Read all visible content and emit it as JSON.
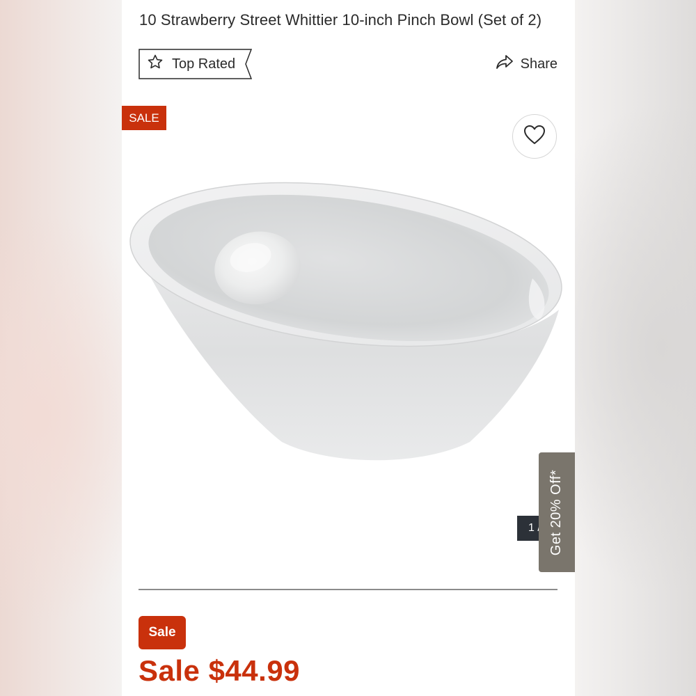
{
  "product": {
    "title": "10 Strawberry Street Whittier 10-inch Pinch Bowl (Set of 2)",
    "image_alt": "White porcelain angled pinch bowl",
    "image_counter": "1 /",
    "sale_badge": "SALE"
  },
  "badges": {
    "top_rated_label": "Top Rated"
  },
  "actions": {
    "share_label": "Share",
    "favorite_icon": "heart-icon"
  },
  "promo": {
    "tab_label": "Get 20% Off*"
  },
  "pricing": {
    "sale_pill": "Sale",
    "price_label": "Sale $44.99"
  },
  "colors": {
    "accent": "#c9310c",
    "promo_tab": "#7a756c",
    "counter_bg": "#2c3138"
  }
}
